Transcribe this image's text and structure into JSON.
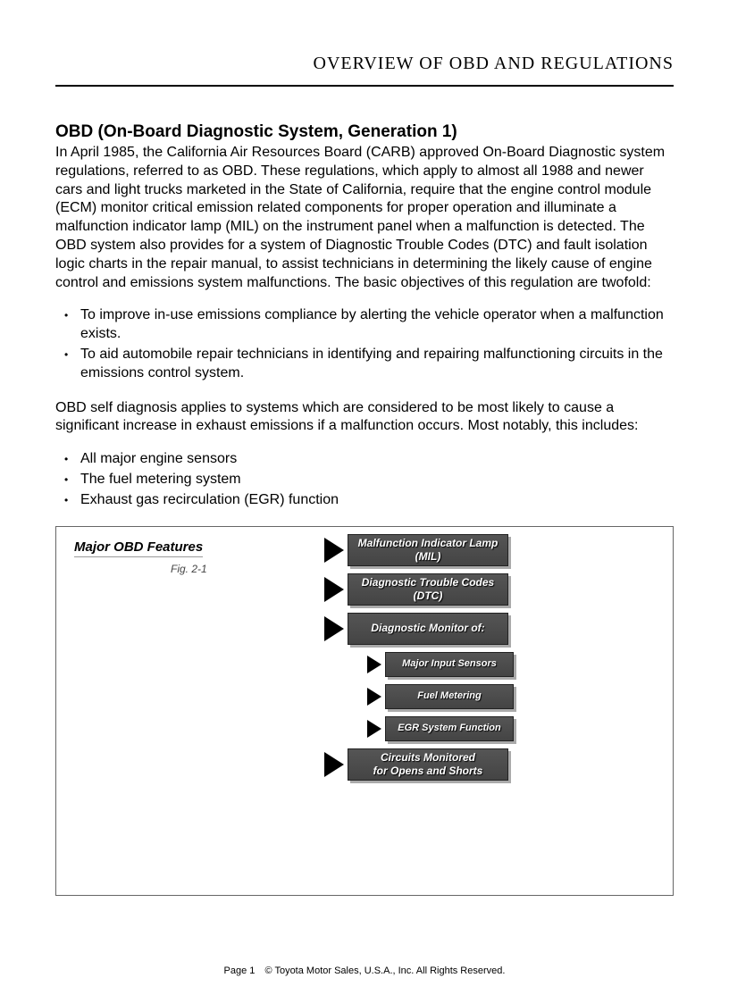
{
  "header": {
    "title": "OVERVIEW OF OBD AND REGULATIONS"
  },
  "section": {
    "title": "OBD (On-Board Diagnostic System, Generation 1)",
    "para1": "In April 1985, the California Air Resources Board (CARB) approved On-Board Diagnostic system regulations, referred to as OBD. These regulations, which apply to almost all 1988 and newer cars and light trucks marketed in the State of California, require that the engine control module (ECM) monitor critical emission related components for proper operation and illuminate a malfunction indicator lamp (MIL) on the instrument panel when a malfunction is detected. The OBD system also provides for a system of Diagnostic Trouble Codes (DTC) and fault isolation logic charts in the repair manual, to assist technicians in determining the likely cause of engine control and emissions system malfunctions. The basic objectives of this regulation are twofold:",
    "bullets1": [
      "To improve in-use emissions compliance by alerting the vehicle operator when a malfunction exists.",
      "To aid automobile repair technicians in identifying and repairing malfunctioning circuits in the emissions control system."
    ],
    "para2": "OBD self diagnosis applies to systems which are considered to be most likely to cause a significant increase in exhaust emissions if a malfunction occurs. Most notably, this includes:",
    "bullets2": [
      "All major engine sensors",
      "The fuel metering system",
      "Exhaust gas recirculation (EGR) function"
    ]
  },
  "figure": {
    "title": "Major OBD Features",
    "caption": "Fig. 2-1",
    "boxes": {
      "b1_line1": "Malfunction Indicator Lamp",
      "b1_line2": "(MIL)",
      "b2_line1": "Diagnostic Trouble Codes",
      "b2_line2": "(DTC)",
      "b3": "Diagnostic Monitor of:",
      "b4": "Major Input Sensors",
      "b5": "Fuel Metering",
      "b6": "EGR System Function",
      "b7_line1": "Circuits Monitored",
      "b7_line2": "for Opens and Shorts"
    }
  },
  "footer": {
    "page": "Page 1",
    "copyright": "© Toyota Motor Sales, U.S.A., Inc. All Rights Reserved."
  }
}
